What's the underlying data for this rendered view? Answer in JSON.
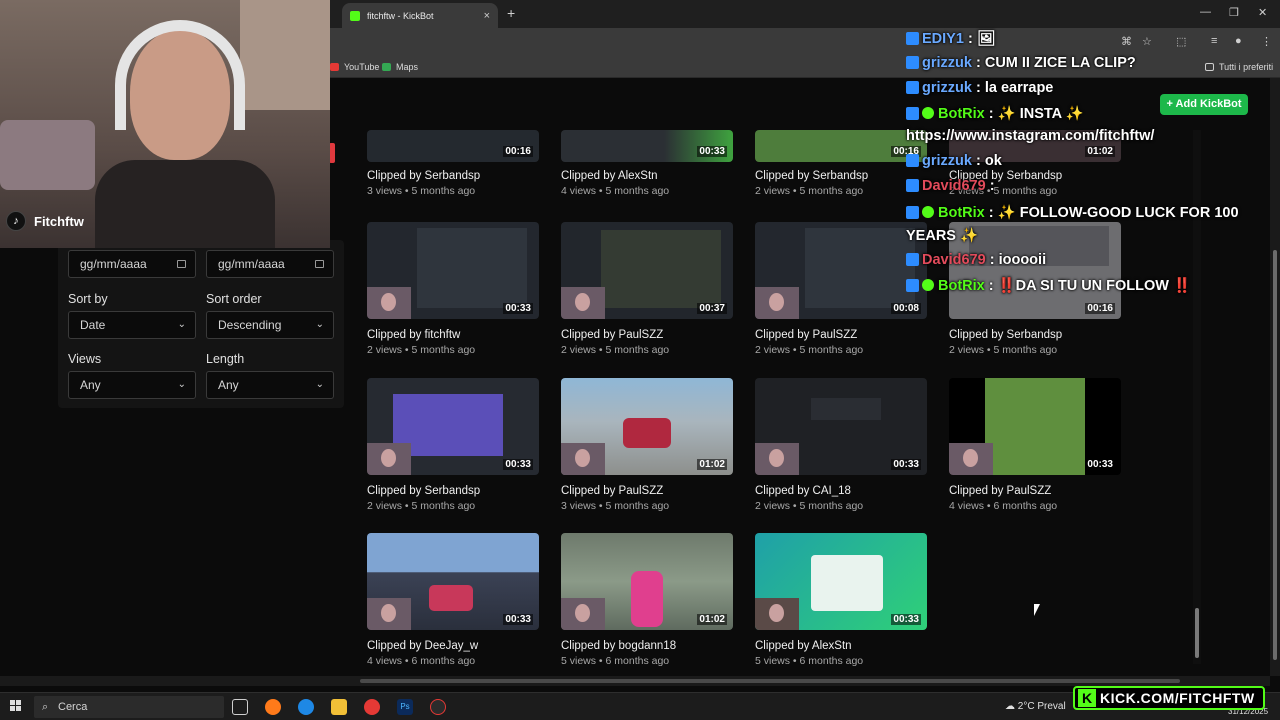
{
  "browser": {
    "tab_title": "fitchftw - KickBot",
    "new_tab": "+",
    "close_tab": "×",
    "bookmarks": [
      "YouTube",
      "Maps"
    ],
    "all_bookmarks": "Tutti i preferiti",
    "window_controls": [
      "—",
      "❐",
      "✕"
    ]
  },
  "page": {
    "add_button": "+ Add KickBot"
  },
  "filters": {
    "date_from_placeholder": "gg/mm/aaaa",
    "date_to_placeholder": "gg/mm/aaaa",
    "sort_by_label": "Sort by",
    "sort_by_value": "Date",
    "sort_order_label": "Sort order",
    "sort_order_value": "Descending",
    "views_label": "Views",
    "views_value": "Any",
    "length_label": "Length",
    "length_value": "Any"
  },
  "clips": [
    {
      "by": "Clipped by Serbandsp",
      "meta": "3 views • 5 months ago",
      "dur": "00:16"
    },
    {
      "by": "Clipped by AlexStn",
      "meta": "4 views • 5 months ago",
      "dur": "00:33"
    },
    {
      "by": "Clipped by Serbandsp",
      "meta": "2 views • 5 months ago",
      "dur": "00:16"
    },
    {
      "by": "Clipped by Serbandsp",
      "meta": "2 views • 5 months ago",
      "dur": "01:02"
    },
    {
      "by": "Clipped by fitchftw",
      "meta": "2 views • 5 months ago",
      "dur": "00:33"
    },
    {
      "by": "Clipped by PaulSZZ",
      "meta": "2 views • 5 months ago",
      "dur": "00:37"
    },
    {
      "by": "Clipped by PaulSZZ",
      "meta": "2 views • 5 months ago",
      "dur": "00:08"
    },
    {
      "by": "Clipped by Serbandsp",
      "meta": "2 views • 5 months ago",
      "dur": "00:16"
    },
    {
      "by": "Clipped by Serbandsp",
      "meta": "2 views • 5 months ago",
      "dur": "00:33"
    },
    {
      "by": "Clipped by PaulSZZ",
      "meta": "3 views • 5 months ago",
      "dur": "01:02"
    },
    {
      "by": "Clipped by CAI_18",
      "meta": "2 views • 5 months ago",
      "dur": "00:33"
    },
    {
      "by": "Clipped by PaulSZZ",
      "meta": "4 views • 6 months ago",
      "dur": "00:33"
    },
    {
      "by": "Clipped by DeeJay_w",
      "meta": "4 views • 6 months ago",
      "dur": "00:33"
    },
    {
      "by": "Clipped by bogdann18",
      "meta": "5 views • 6 months ago",
      "dur": "01:02"
    },
    {
      "by": "Clipped by AlexStn",
      "meta": "5 views • 6 months ago",
      "dur": "00:33"
    }
  ],
  "stream": {
    "tiktok_name": "Fitchftw",
    "kick_banner": "KICK.COM/FITCHFTW"
  },
  "chat": [
    {
      "user": "EDIY1",
      "sep": " : ",
      "msg": "🖼"
    },
    {
      "user": "grizzuk",
      "sep": " : ",
      "msg": "CUM II ZICE LA CLIP?"
    },
    {
      "user": "grizzuk",
      "sep": " : ",
      "msg": "la earrape"
    },
    {
      "user": "BotRix",
      "sep": " : ",
      "msg": "✨ INSTA ✨"
    },
    {
      "user": "",
      "sep": "",
      "msg": "https://www.instagram.com/fitchftw/"
    },
    {
      "user": "grizzuk",
      "sep": " : ",
      "msg": "ok"
    },
    {
      "user": "David679",
      "sep": " : ",
      "msg": ""
    },
    {
      "user": "BotRix",
      "sep": " : ",
      "msg": "✨ FOLLOW-GOOD LUCK FOR 100"
    },
    {
      "user": "",
      "sep": "",
      "msg": "YEARS ✨"
    },
    {
      "user": "David679",
      "sep": " : ",
      "msg": "iooooii"
    },
    {
      "user": "BotRix",
      "sep": " : ",
      "msg": "‼️DA SI TU UN FOLLOW ‼️"
    }
  ],
  "taskbar": {
    "search_placeholder": "Cerca",
    "weather": "2°C  Preval",
    "date": "31/12/2025"
  }
}
